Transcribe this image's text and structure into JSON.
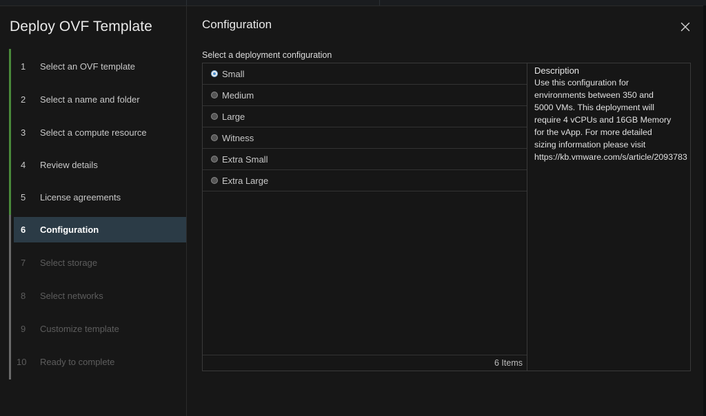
{
  "wizard": {
    "title": "Deploy OVF Template",
    "steps": [
      {
        "num": "1",
        "label": "Select an OVF template",
        "state": "done"
      },
      {
        "num": "2",
        "label": "Select a name and folder",
        "state": "done"
      },
      {
        "num": "3",
        "label": "Select a compute resource",
        "state": "done"
      },
      {
        "num": "4",
        "label": "Review details",
        "state": "done"
      },
      {
        "num": "5",
        "label": "License agreements",
        "state": "done"
      },
      {
        "num": "6",
        "label": "Configuration",
        "state": "active"
      },
      {
        "num": "7",
        "label": "Select storage",
        "state": "disabled"
      },
      {
        "num": "8",
        "label": "Select networks",
        "state": "disabled"
      },
      {
        "num": "9",
        "label": "Customize template",
        "state": "disabled"
      },
      {
        "num": "10",
        "label": "Ready to complete",
        "state": "disabled"
      }
    ]
  },
  "main": {
    "title": "Configuration",
    "close_icon": "close-icon",
    "section_label": "Select a deployment configuration",
    "options": [
      {
        "label": "Small",
        "selected": true
      },
      {
        "label": "Medium",
        "selected": false
      },
      {
        "label": "Large",
        "selected": false
      },
      {
        "label": "Witness",
        "selected": false
      },
      {
        "label": "Extra Small",
        "selected": false
      },
      {
        "label": "Extra Large",
        "selected": false
      }
    ],
    "item_count": "6 Items",
    "description": {
      "title": "Description",
      "lines": [
        "Use this configuration for",
        "environments between 350 and",
        "5000 VMs. This deployment will",
        "require 4 vCPUs and 16GB Memory",
        "for the vApp. For more detailed",
        "sizing information please visit",
        "https://kb.vmware.com/s/article/2093783"
      ]
    }
  },
  "colors": {
    "background": "#171717",
    "active_step": "#2b3b46",
    "completed_rail": "#4a8a3a",
    "border": "#3a3a3a"
  }
}
